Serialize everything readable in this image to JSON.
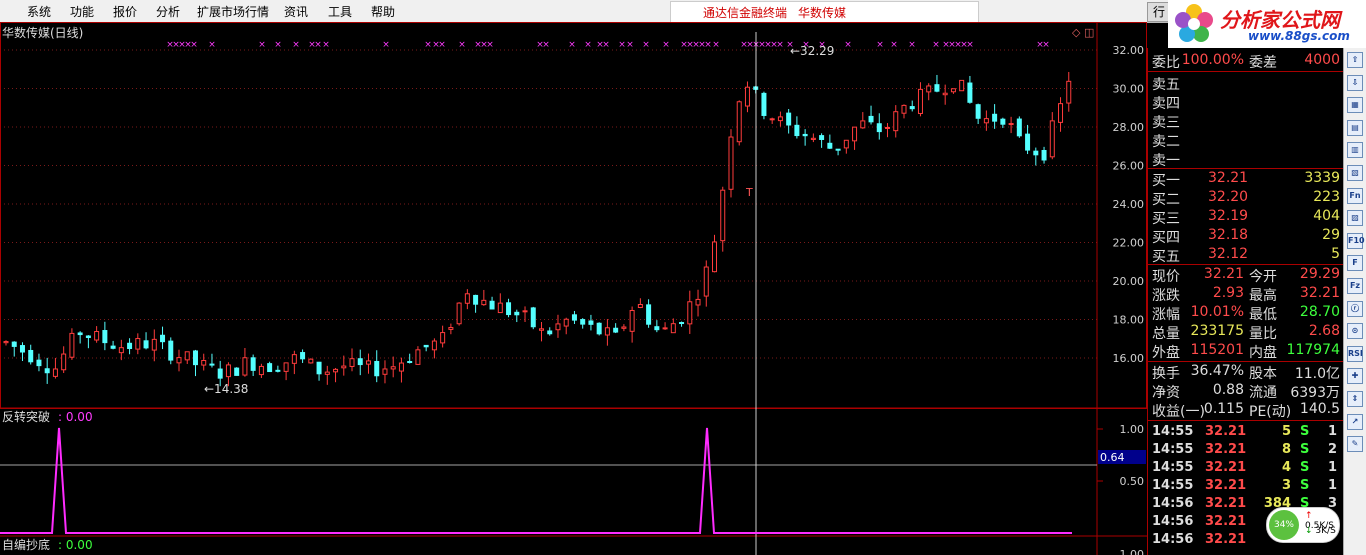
{
  "menu": [
    "系统",
    "功能",
    "报价",
    "分析",
    "扩展市场行情",
    "资讯",
    "工具",
    "帮助"
  ],
  "title_links": [
    "通达信金融终端",
    "华数传媒"
  ],
  "hang_tab": "行",
  "logo": {
    "title": "分析家公式网",
    "url": "www.88gs.com"
  },
  "chart": {
    "title": "华数传媒(日线)",
    "y_labels": [
      "32.00",
      "30.00",
      "28.00",
      "26.00",
      "24.00",
      "22.00",
      "20.00",
      "18.00",
      "16.00"
    ],
    "high_label": "32.29",
    "low_label": "14.38",
    "t_marker": "T",
    "x_marker": "×",
    "top_right_icons": "◇ ◫",
    "indicator1": {
      "name": "反转突破",
      "value": "0.00",
      "y_labels": [
        "1.00",
        "0.50"
      ],
      "cursor_value": "0.64"
    },
    "indicator2": {
      "name": "自编抄底",
      "value": "0.00",
      "y_labels": [
        "1.00"
      ]
    }
  },
  "panel": {
    "weibi": {
      "label": "委比",
      "value": "100.00%",
      "label2": "委差",
      "value2": "4000"
    },
    "sells": [
      {
        "label": "卖五"
      },
      {
        "label": "卖四"
      },
      {
        "label": "卖三"
      },
      {
        "label": "卖二"
      },
      {
        "label": "卖一"
      }
    ],
    "buys": [
      {
        "label": "买一",
        "price": "32.21",
        "vol": "3339"
      },
      {
        "label": "买二",
        "price": "32.20",
        "vol": "223"
      },
      {
        "label": "买三",
        "price": "32.19",
        "vol": "404"
      },
      {
        "label": "买四",
        "price": "32.18",
        "vol": "29"
      },
      {
        "label": "买五",
        "price": "32.12",
        "vol": "5"
      }
    ],
    "stats": [
      {
        "l1": "现价",
        "v1": "32.21",
        "l2": "今开",
        "v2": "29.29"
      },
      {
        "l1": "涨跌",
        "v1": "2.93",
        "l2": "最高",
        "v2": "32.21"
      },
      {
        "l1": "涨幅",
        "v1": "10.01%",
        "l2": "最低",
        "v2": "28.70"
      },
      {
        "l1": "总量",
        "v1": "233175",
        "l2": "量比",
        "v2": "2.68"
      },
      {
        "l1": "外盘",
        "v1": "115201",
        "l2": "内盘",
        "v2": "117974"
      }
    ],
    "stats2": [
      {
        "l1": "换手",
        "v1": "36.47%",
        "l2": "股本",
        "v2": "11.0亿"
      },
      {
        "l1": "净资",
        "v1": "0.88",
        "l2": "流通",
        "v2": "6393万"
      },
      {
        "l1": "收益(一)",
        "v1": "0.115",
        "l2": "PE(动)",
        "v2": "140.5"
      }
    ],
    "ticks": [
      {
        "time": "14:55",
        "price": "32.21",
        "vol": "5",
        "bs": "S",
        "n": "1"
      },
      {
        "time": "14:55",
        "price": "32.21",
        "vol": "8",
        "bs": "S",
        "n": "2"
      },
      {
        "time": "14:55",
        "price": "32.21",
        "vol": "4",
        "bs": "S",
        "n": "1"
      },
      {
        "time": "14:55",
        "price": "32.21",
        "vol": "3",
        "bs": "S",
        "n": "1"
      },
      {
        "time": "14:56",
        "price": "32.21",
        "vol": "384",
        "bs": "S",
        "n": "3"
      },
      {
        "time": "14:56",
        "price": "32.21",
        "vol": "",
        "bs": "",
        "n": ""
      },
      {
        "time": "14:56",
        "price": "32.21",
        "vol": "",
        "bs": "",
        "n": ""
      }
    ]
  },
  "netmeter": {
    "pct": "34%",
    "up": "0.5K/S",
    "down": "3K/S"
  },
  "toolbar_icons": [
    "⇧",
    "⇩",
    "▦",
    "▤",
    "▥",
    "▧",
    "Fn",
    "▨",
    "F10",
    "F",
    "Fz",
    "ⓡ",
    "⊙",
    "RSI",
    "✚",
    "⇕",
    "↗",
    "✎"
  ]
}
